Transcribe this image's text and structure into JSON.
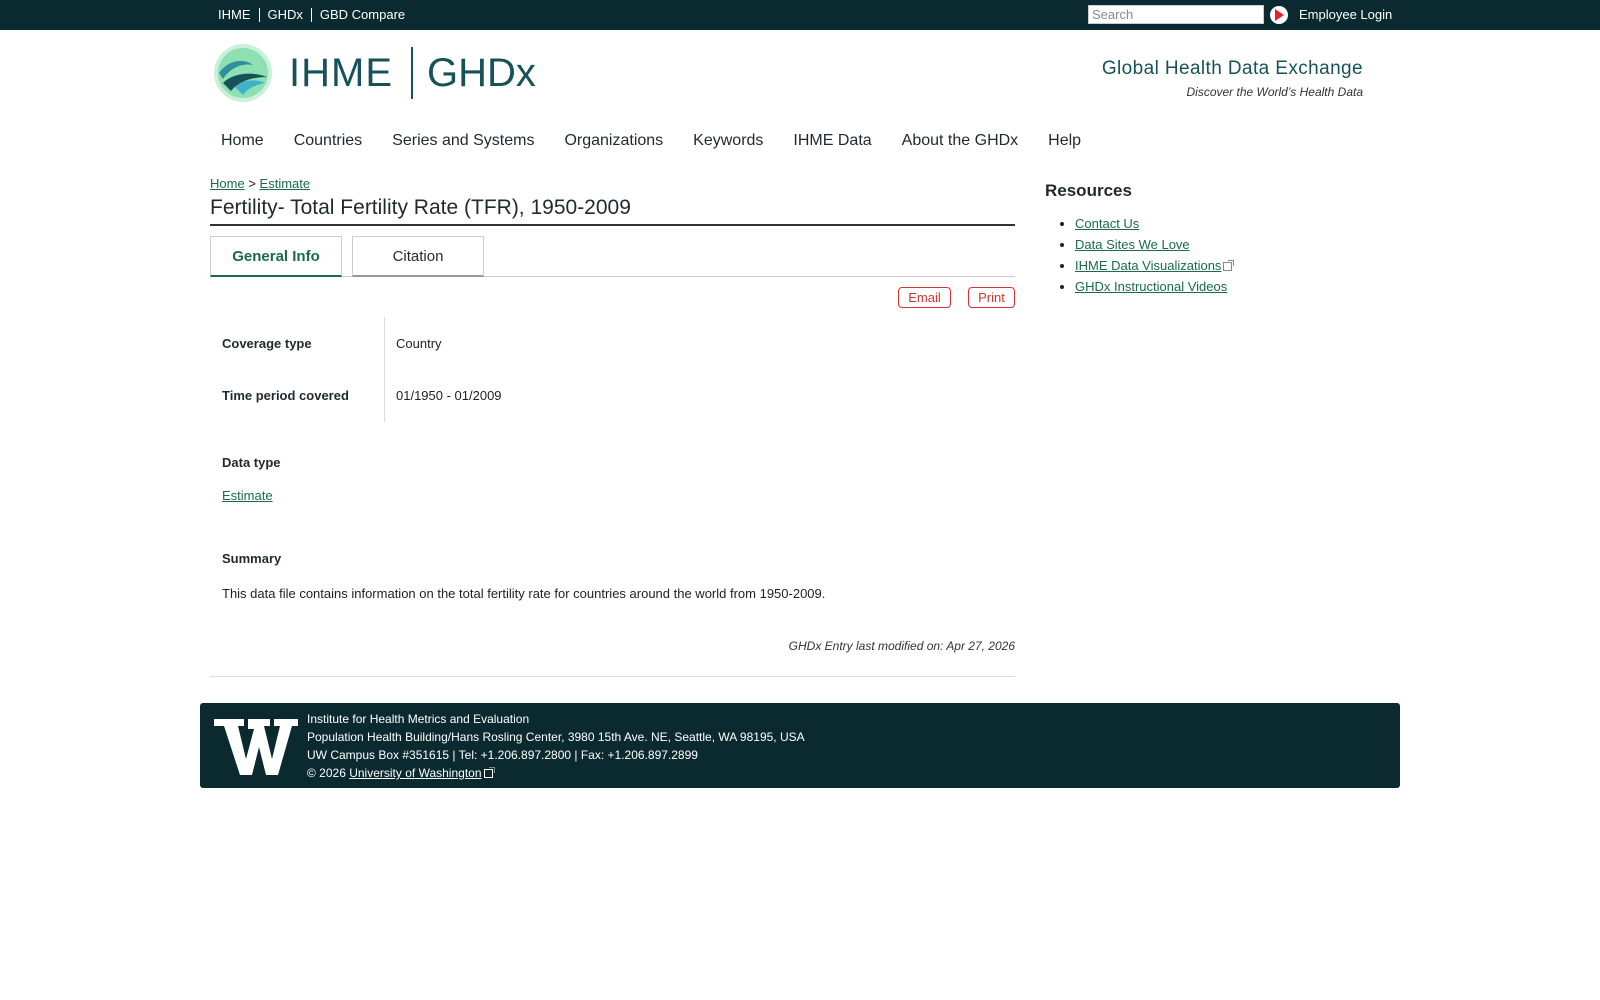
{
  "topbar": {
    "links": [
      "IHME",
      "GHDx",
      "GBD Compare"
    ],
    "search_placeholder": "Search",
    "login": "Employee Login"
  },
  "header": {
    "logo_ihme": "IHME",
    "logo_ghdx": "GHDx",
    "tagline": "Global Health Data Exchange",
    "subtagline": "Discover the World’s Health Data"
  },
  "nav": [
    "Home",
    "Countries",
    "Series and Systems",
    "Organizations",
    "Keywords",
    "IHME Data",
    "About the GHDx",
    "Help"
  ],
  "breadcrumb": {
    "home": "Home",
    "separator": ">",
    "current": "Estimate"
  },
  "page_title": "Fertility- Total Fertility Rate (TFR), 1950-2009",
  "tabs": [
    "General Info",
    "Citation"
  ],
  "actions": {
    "email": "Email",
    "print": "Print"
  },
  "fields": [
    {
      "label": "Coverage type",
      "value": "Country"
    },
    {
      "label": "Time period covered",
      "value": "01/1950 - 01/2009"
    }
  ],
  "data_type": {
    "label": "Data type",
    "value": "Estimate"
  },
  "summary": {
    "label": "Summary",
    "text": "This data file contains information on the total fertility rate for countries around the world from 1950-2009."
  },
  "last_modified": "GHDx Entry last modified on: Apr 27, 2026",
  "sidebar": {
    "title": "Resources",
    "links": [
      "Contact Us",
      "Data Sites We Love",
      "IHME Data Visualizations",
      "GHDx Instructional Videos"
    ]
  },
  "footer": {
    "line1": "Institute for Health Metrics and Evaluation",
    "line2": "Population Health Building/Hans Rosling Center, 3980 15th Ave. NE, Seattle, WA 98195, USA",
    "line3": "UW Campus Box #351615 | Tel: +1.206.897.2800 | Fax: +1.206.897.2899",
    "copyright": "© 2026",
    "uw_link": "University of Washington"
  },
  "colors": {
    "topbar": "#0b2a2f",
    "brand": "#17515a",
    "link": "#1a6b4a",
    "action": "#d6352e"
  }
}
